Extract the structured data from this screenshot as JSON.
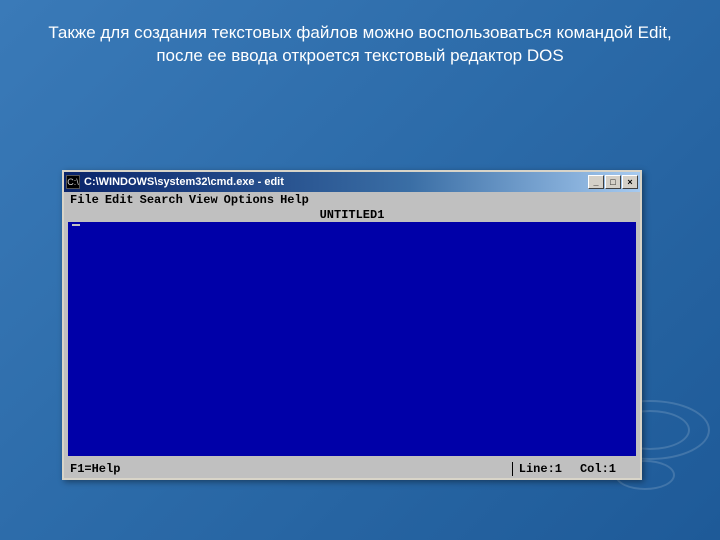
{
  "caption": "Также для создания текстовых файлов можно воспользоваться командой Edit, после ее ввода откроется текстовый редактор DOS",
  "window": {
    "title": "C:\\WINDOWS\\system32\\cmd.exe - edit",
    "sysicon_glyph": "C:\\",
    "buttons": {
      "minimize": "_",
      "maximize": "□",
      "close": "×"
    }
  },
  "menu": {
    "file": "File",
    "edit": "Edit",
    "search": "Search",
    "view": "View",
    "options": "Options",
    "help": "Help"
  },
  "document_title": "UNTITLED1",
  "status": {
    "help": "F1=Help",
    "line_label": "Line:",
    "line_value": "1",
    "col_label": "Col:",
    "col_value": "1"
  }
}
